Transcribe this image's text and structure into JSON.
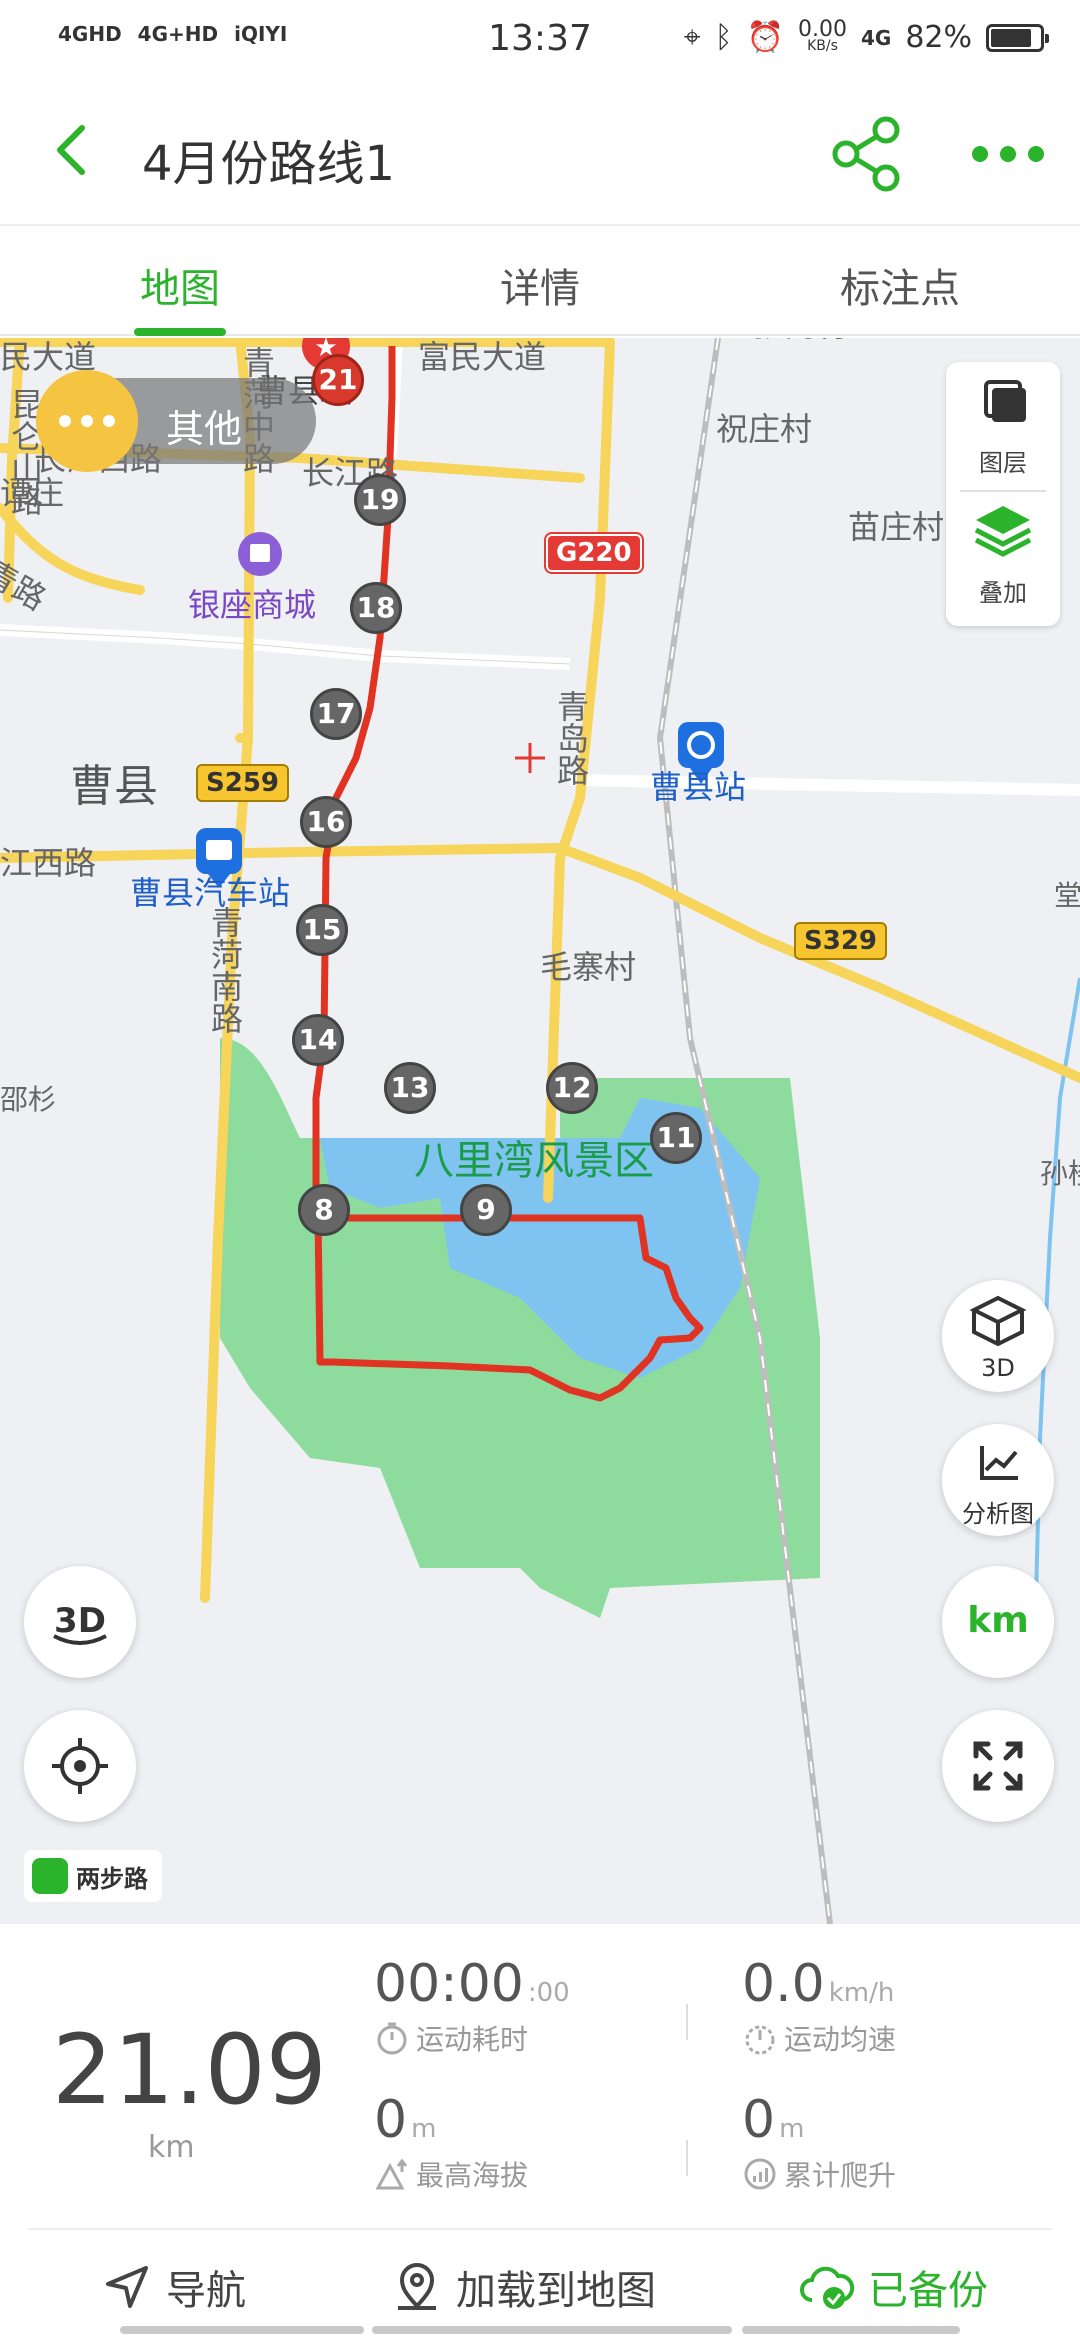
{
  "status_bar": {
    "network_1": "4GHD",
    "network_2": "4G+HD",
    "app_icon": "iQIYI",
    "time": "13:37",
    "speed_value": "0.00",
    "speed_unit": "KB/s",
    "network_3": "4G",
    "battery": "82%"
  },
  "header": {
    "title": "4月份路线1",
    "back_icon": "chevron-left-icon",
    "share_icon": "share-icon",
    "more_icon": "more-dots-icon"
  },
  "tabs": [
    {
      "label": "地图",
      "active": true
    },
    {
      "label": "详情",
      "active": false
    },
    {
      "label": "标注点",
      "active": false
    }
  ],
  "map": {
    "other_button": "其他",
    "layer_button": "图层",
    "overlay_button": "叠加",
    "view_3d_button": "3D",
    "analysis_button": "分析图",
    "unit_button": "km",
    "brand": "两步路",
    "place_labels": {
      "fumin_avenue_left": "民大道",
      "fumin_avenue": "富民大道",
      "qinghe_middle_road": "青菏中路",
      "kunlunshan_road": "昆仑山路",
      "county_gov": "曹县政",
      "changjiang_west_road": "长江西路",
      "changjiang_road": "长江路",
      "tanzhuang": "谭庄",
      "qing_road_left": "青路",
      "zhanggang_village": "张岗村",
      "zhuzhuang_village": "祝庄村",
      "miaozhuang_village": "苗庄村",
      "yinzuo_mall": "银座商城",
      "qingdao_road": "青岛路",
      "caoxian": "曹县",
      "caoxian_station": "曹县站",
      "west_road_left": "江西路",
      "caoxian_bus_station": "曹县汽车站",
      "qinghe_south_road": "青菏南路",
      "maozhai_village": "毛寨村",
      "bailiwan_scenic": "八里湾风景区",
      "zhuang_left": "邵杉",
      "zhuang_right": "孙楼",
      "tang_right": "堂"
    },
    "road_signs": {
      "g220": "G220",
      "s259": "S259",
      "s329": "S329"
    },
    "route_markers": [
      "21",
      "19",
      "18",
      "17",
      "16",
      "15",
      "14",
      "13",
      "12",
      "11",
      "9",
      "8"
    ],
    "colors": {
      "route": "#e03322",
      "major_road": "#f7d45a",
      "minor_road": "#ffffff",
      "water": "#7fc3f0",
      "park": "#8edb9e",
      "map_bg": "#eef0f4"
    }
  },
  "stats": {
    "total_distance": "21.09",
    "total_unit": "km",
    "duration_main": "00:00",
    "duration_sec": ":00",
    "duration_label": "运动耗时",
    "avg_speed": "0.0",
    "avg_speed_unit": "km/h",
    "avg_speed_label": "运动均速",
    "max_altitude": "0",
    "max_altitude_unit": "m",
    "max_altitude_label": "最高海拔",
    "total_climb": "0",
    "total_climb_unit": "m",
    "total_climb_label": "累计爬升"
  },
  "actions": {
    "navigate": "导航",
    "load_to_map": "加载到地图",
    "backed_up": "已备份"
  }
}
